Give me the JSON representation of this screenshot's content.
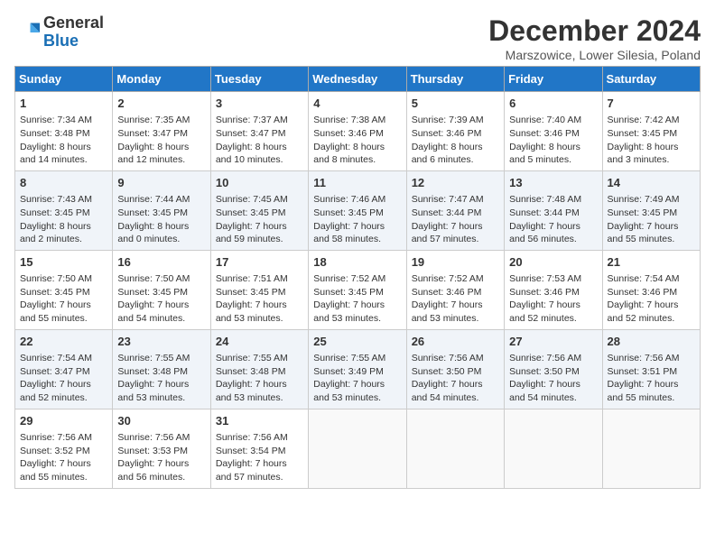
{
  "logo": {
    "line1": "General",
    "line2": "Blue"
  },
  "title": "December 2024",
  "subtitle": "Marszowice, Lower Silesia, Poland",
  "days_of_week": [
    "Sunday",
    "Monday",
    "Tuesday",
    "Wednesday",
    "Thursday",
    "Friday",
    "Saturday"
  ],
  "weeks": [
    [
      {
        "day": "1",
        "lines": [
          "Sunrise: 7:34 AM",
          "Sunset: 3:48 PM",
          "Daylight: 8 hours",
          "and 14 minutes."
        ]
      },
      {
        "day": "2",
        "lines": [
          "Sunrise: 7:35 AM",
          "Sunset: 3:47 PM",
          "Daylight: 8 hours",
          "and 12 minutes."
        ]
      },
      {
        "day": "3",
        "lines": [
          "Sunrise: 7:37 AM",
          "Sunset: 3:47 PM",
          "Daylight: 8 hours",
          "and 10 minutes."
        ]
      },
      {
        "day": "4",
        "lines": [
          "Sunrise: 7:38 AM",
          "Sunset: 3:46 PM",
          "Daylight: 8 hours",
          "and 8 minutes."
        ]
      },
      {
        "day": "5",
        "lines": [
          "Sunrise: 7:39 AM",
          "Sunset: 3:46 PM",
          "Daylight: 8 hours",
          "and 6 minutes."
        ]
      },
      {
        "day": "6",
        "lines": [
          "Sunrise: 7:40 AM",
          "Sunset: 3:46 PM",
          "Daylight: 8 hours",
          "and 5 minutes."
        ]
      },
      {
        "day": "7",
        "lines": [
          "Sunrise: 7:42 AM",
          "Sunset: 3:45 PM",
          "Daylight: 8 hours",
          "and 3 minutes."
        ]
      }
    ],
    [
      {
        "day": "8",
        "lines": [
          "Sunrise: 7:43 AM",
          "Sunset: 3:45 PM",
          "Daylight: 8 hours",
          "and 2 minutes."
        ]
      },
      {
        "day": "9",
        "lines": [
          "Sunrise: 7:44 AM",
          "Sunset: 3:45 PM",
          "Daylight: 8 hours",
          "and 0 minutes."
        ]
      },
      {
        "day": "10",
        "lines": [
          "Sunrise: 7:45 AM",
          "Sunset: 3:45 PM",
          "Daylight: 7 hours",
          "and 59 minutes."
        ]
      },
      {
        "day": "11",
        "lines": [
          "Sunrise: 7:46 AM",
          "Sunset: 3:45 PM",
          "Daylight: 7 hours",
          "and 58 minutes."
        ]
      },
      {
        "day": "12",
        "lines": [
          "Sunrise: 7:47 AM",
          "Sunset: 3:44 PM",
          "Daylight: 7 hours",
          "and 57 minutes."
        ]
      },
      {
        "day": "13",
        "lines": [
          "Sunrise: 7:48 AM",
          "Sunset: 3:44 PM",
          "Daylight: 7 hours",
          "and 56 minutes."
        ]
      },
      {
        "day": "14",
        "lines": [
          "Sunrise: 7:49 AM",
          "Sunset: 3:45 PM",
          "Daylight: 7 hours",
          "and 55 minutes."
        ]
      }
    ],
    [
      {
        "day": "15",
        "lines": [
          "Sunrise: 7:50 AM",
          "Sunset: 3:45 PM",
          "Daylight: 7 hours",
          "and 55 minutes."
        ]
      },
      {
        "day": "16",
        "lines": [
          "Sunrise: 7:50 AM",
          "Sunset: 3:45 PM",
          "Daylight: 7 hours",
          "and 54 minutes."
        ]
      },
      {
        "day": "17",
        "lines": [
          "Sunrise: 7:51 AM",
          "Sunset: 3:45 PM",
          "Daylight: 7 hours",
          "and 53 minutes."
        ]
      },
      {
        "day": "18",
        "lines": [
          "Sunrise: 7:52 AM",
          "Sunset: 3:45 PM",
          "Daylight: 7 hours",
          "and 53 minutes."
        ]
      },
      {
        "day": "19",
        "lines": [
          "Sunrise: 7:52 AM",
          "Sunset: 3:46 PM",
          "Daylight: 7 hours",
          "and 53 minutes."
        ]
      },
      {
        "day": "20",
        "lines": [
          "Sunrise: 7:53 AM",
          "Sunset: 3:46 PM",
          "Daylight: 7 hours",
          "and 52 minutes."
        ]
      },
      {
        "day": "21",
        "lines": [
          "Sunrise: 7:54 AM",
          "Sunset: 3:46 PM",
          "Daylight: 7 hours",
          "and 52 minutes."
        ]
      }
    ],
    [
      {
        "day": "22",
        "lines": [
          "Sunrise: 7:54 AM",
          "Sunset: 3:47 PM",
          "Daylight: 7 hours",
          "and 52 minutes."
        ]
      },
      {
        "day": "23",
        "lines": [
          "Sunrise: 7:55 AM",
          "Sunset: 3:48 PM",
          "Daylight: 7 hours",
          "and 53 minutes."
        ]
      },
      {
        "day": "24",
        "lines": [
          "Sunrise: 7:55 AM",
          "Sunset: 3:48 PM",
          "Daylight: 7 hours",
          "and 53 minutes."
        ]
      },
      {
        "day": "25",
        "lines": [
          "Sunrise: 7:55 AM",
          "Sunset: 3:49 PM",
          "Daylight: 7 hours",
          "and 53 minutes."
        ]
      },
      {
        "day": "26",
        "lines": [
          "Sunrise: 7:56 AM",
          "Sunset: 3:50 PM",
          "Daylight: 7 hours",
          "and 54 minutes."
        ]
      },
      {
        "day": "27",
        "lines": [
          "Sunrise: 7:56 AM",
          "Sunset: 3:50 PM",
          "Daylight: 7 hours",
          "and 54 minutes."
        ]
      },
      {
        "day": "28",
        "lines": [
          "Sunrise: 7:56 AM",
          "Sunset: 3:51 PM",
          "Daylight: 7 hours",
          "and 55 minutes."
        ]
      }
    ],
    [
      {
        "day": "29",
        "lines": [
          "Sunrise: 7:56 AM",
          "Sunset: 3:52 PM",
          "Daylight: 7 hours",
          "and 55 minutes."
        ]
      },
      {
        "day": "30",
        "lines": [
          "Sunrise: 7:56 AM",
          "Sunset: 3:53 PM",
          "Daylight: 7 hours",
          "and 56 minutes."
        ]
      },
      {
        "day": "31",
        "lines": [
          "Sunrise: 7:56 AM",
          "Sunset: 3:54 PM",
          "Daylight: 7 hours",
          "and 57 minutes."
        ]
      },
      null,
      null,
      null,
      null
    ]
  ]
}
